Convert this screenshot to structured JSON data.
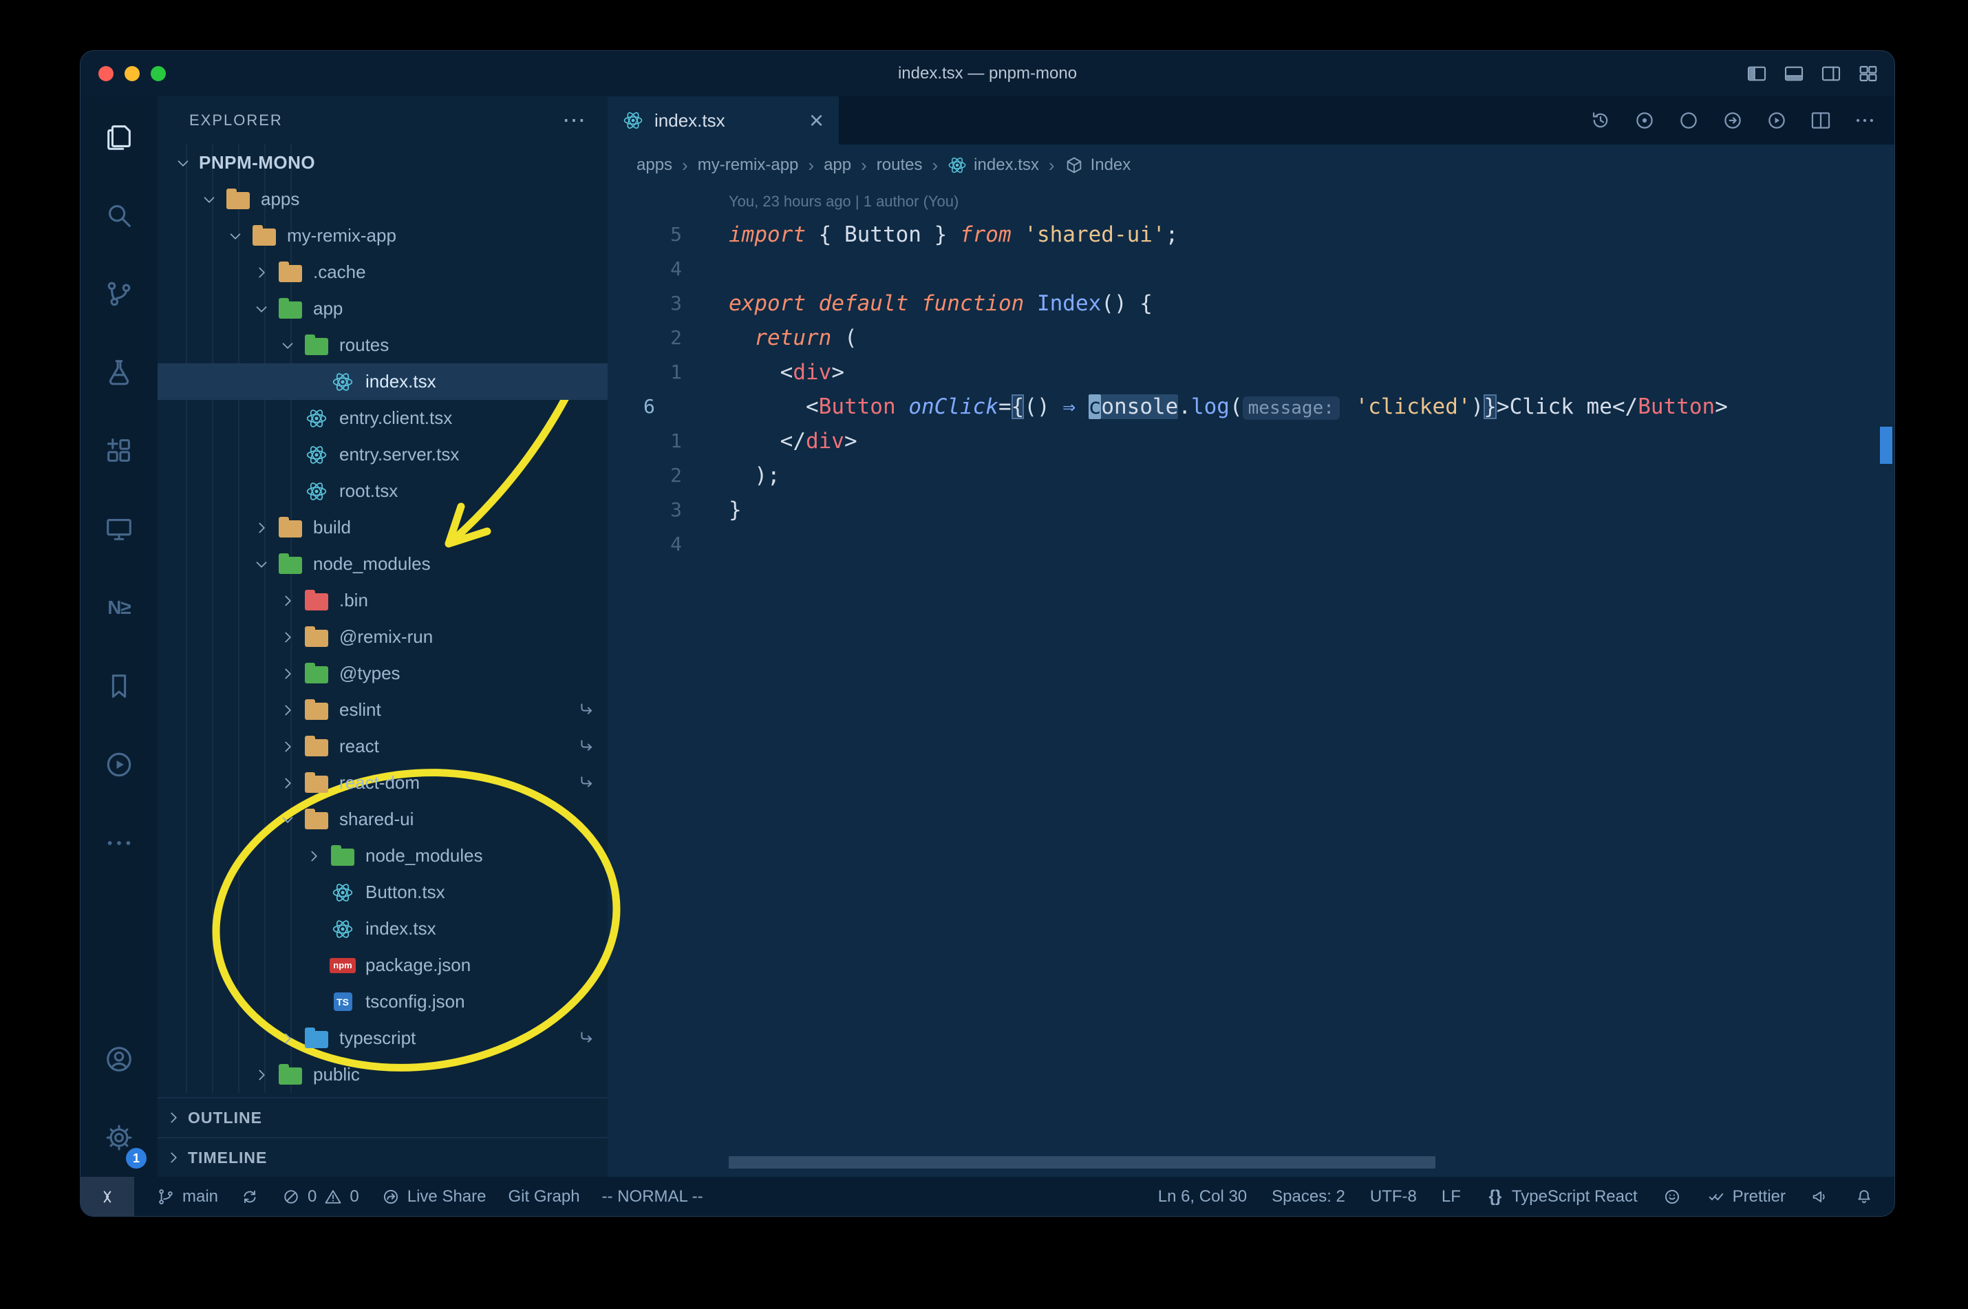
{
  "colors": {
    "editor_bg": "#0e2a44",
    "panel_bg": "#07192c",
    "sidebar_bg": "#0c2439",
    "activity_bg": "#091d31",
    "titlebar_bg": "#0a1e33",
    "statusbar_bg": "#081d31",
    "selection_row": "#1c3a57",
    "text": "#d6deeb",
    "dim": "#8ea6bf",
    "accent": "#82aaff",
    "keyword": "#f78c6c",
    "string": "#ecc48d",
    "tag": "#f07178",
    "folder_tan": "#d7a65f",
    "folder_green": "#4fae52",
    "folder_red": "#e25f5f",
    "folder_blue": "#3f9bd8",
    "react": "#58c4dc",
    "npm": "#cb3837",
    "ts": "#3178c6",
    "cursor": "#7ea6c9",
    "scroll_mark": "#3b8eea",
    "badge": "#2f7fe0",
    "annotation": "#f1e32b",
    "traffic_red": "#ff5f57",
    "traffic_yellow": "#febc2e",
    "traffic_green": "#28c840"
  },
  "titlebar": {
    "title": "index.tsx — pnpm-mono",
    "icons": [
      "layout-sidebar",
      "layout-panel",
      "layout-sidebar-right",
      "layout-grid"
    ]
  },
  "activity_bar": {
    "items": [
      {
        "name": "explorer",
        "icon": "files",
        "active": true
      },
      {
        "name": "search",
        "icon": "search"
      },
      {
        "name": "source-control",
        "icon": "source-control"
      },
      {
        "name": "testing",
        "icon": "flask"
      },
      {
        "name": "extensions",
        "icon": "extensions"
      },
      {
        "name": "remote-explorer",
        "icon": "remote"
      },
      {
        "name": "nx-console",
        "icon": "nx"
      },
      {
        "name": "bookmarks",
        "icon": "bookmark"
      },
      {
        "name": "code-runner",
        "icon": "circle-play-big"
      },
      {
        "name": "more-tools",
        "icon": "more"
      }
    ],
    "bottom": [
      {
        "name": "accounts",
        "icon": "account"
      },
      {
        "name": "settings",
        "icon": "gear",
        "badge": "1"
      }
    ]
  },
  "sidebar": {
    "header": "EXPLORER",
    "more": "⋯",
    "tree": [
      {
        "label": "PNPM-MONO",
        "level": 0,
        "kind": "root",
        "chevron": "down"
      },
      {
        "label": "apps",
        "level": 1,
        "kind": "folder",
        "color": "tan",
        "chevron": "down"
      },
      {
        "label": "my-remix-app",
        "level": 2,
        "kind": "folder",
        "color": "tan",
        "chevron": "down"
      },
      {
        "label": ".cache",
        "level": 3,
        "kind": "folder",
        "color": "tan",
        "chevron": "right"
      },
      {
        "label": "app",
        "level": 3,
        "kind": "folder",
        "color": "green",
        "chevron": "down"
      },
      {
        "label": "routes",
        "level": 4,
        "kind": "folder",
        "color": "green",
        "chevron": "down"
      },
      {
        "label": "index.tsx",
        "level": 5,
        "kind": "react",
        "selected": true
      },
      {
        "label": "entry.client.tsx",
        "level": 4,
        "kind": "react"
      },
      {
        "label": "entry.server.tsx",
        "level": 4,
        "kind": "react"
      },
      {
        "label": "root.tsx",
        "level": 4,
        "kind": "react"
      },
      {
        "label": "build",
        "level": 3,
        "kind": "folder",
        "color": "tan",
        "chevron": "right"
      },
      {
        "label": "node_modules",
        "level": 3,
        "kind": "folder",
        "color": "green",
        "chevron": "down"
      },
      {
        "label": ".bin",
        "level": 4,
        "kind": "folder",
        "color": "red",
        "chevron": "right"
      },
      {
        "label": "@remix-run",
        "level": 4,
        "kind": "folder",
        "color": "tan",
        "chevron": "right"
      },
      {
        "label": "@types",
        "level": 4,
        "kind": "folder",
        "color": "green",
        "chevron": "right"
      },
      {
        "label": "eslint",
        "level": 4,
        "kind": "folder",
        "color": "tan",
        "chevron": "right",
        "symlink": true
      },
      {
        "label": "react",
        "level": 4,
        "kind": "folder",
        "color": "tan",
        "chevron": "right",
        "symlink": true
      },
      {
        "label": "react-dom",
        "level": 4,
        "kind": "folder",
        "color": "tan",
        "chevron": "right",
        "symlink": true
      },
      {
        "label": "shared-ui",
        "level": 4,
        "kind": "folder",
        "color": "tan",
        "chevron": "down"
      },
      {
        "label": "node_modules",
        "level": 5,
        "kind": "folder",
        "color": "green",
        "chevron": "right"
      },
      {
        "label": "Button.tsx",
        "level": 5,
        "kind": "react"
      },
      {
        "label": "index.tsx",
        "level": 5,
        "kind": "react"
      },
      {
        "label": "package.json",
        "level": 5,
        "kind": "npm"
      },
      {
        "label": "tsconfig.json",
        "level": 5,
        "kind": "ts"
      },
      {
        "label": "typescript",
        "level": 4,
        "kind": "folder",
        "color": "blue",
        "chevron": "right",
        "symlink": true
      },
      {
        "label": "public",
        "level": 3,
        "kind": "folder",
        "color": "green",
        "chevron": "right"
      }
    ],
    "sections": [
      "OUTLINE",
      "TIMELINE"
    ]
  },
  "editor": {
    "tab": {
      "label": "index.tsx",
      "icon": "react",
      "close": "×"
    },
    "actions": [
      "history",
      "circle-dot",
      "circle-outline",
      "circle-arrow",
      "circle-play",
      "split",
      "more"
    ],
    "breadcrumbs": [
      {
        "label": "apps"
      },
      {
        "label": "my-remix-app"
      },
      {
        "label": "app"
      },
      {
        "label": "routes"
      },
      {
        "label": "index.tsx",
        "icon": "react"
      },
      {
        "label": "Index",
        "icon": "cube"
      }
    ],
    "codelens": "You, 23 hours ago | 1 author (You)",
    "code": {
      "lines": [
        {
          "num": "5",
          "tokens": [
            {
              "t": "import",
              "c": "kw"
            },
            {
              "t": " { ",
              "c": "pn"
            },
            {
              "t": "Button",
              "c": "var"
            },
            {
              "t": " } ",
              "c": "pn"
            },
            {
              "t": "from",
              "c": "kw"
            },
            {
              "t": " ",
              "c": "pn"
            },
            {
              "t": "'shared-ui'",
              "c": "str"
            },
            {
              "t": ";",
              "c": "pn"
            }
          ]
        },
        {
          "num": "4",
          "tokens": []
        },
        {
          "num": "3",
          "tokens": [
            {
              "t": "export",
              "c": "kw"
            },
            {
              "t": " ",
              "c": "pn"
            },
            {
              "t": "default",
              "c": "kw"
            },
            {
              "t": " ",
              "c": "pn"
            },
            {
              "t": "function",
              "c": "kw"
            },
            {
              "t": " ",
              "c": "pn"
            },
            {
              "t": "Index",
              "c": "fn"
            },
            {
              "t": "() {",
              "c": "pn"
            }
          ]
        },
        {
          "num": "2",
          "tokens": [
            {
              "t": "  ",
              "c": "pn"
            },
            {
              "t": "return",
              "c": "kw"
            },
            {
              "t": " (",
              "c": "pn"
            }
          ]
        },
        {
          "num": "1",
          "tokens": [
            {
              "t": "    <",
              "c": "pn"
            },
            {
              "t": "div",
              "c": "tag"
            },
            {
              "t": ">",
              "c": "pn"
            }
          ]
        },
        {
          "num": "6",
          "current": true,
          "tokens": [
            {
              "t": "      <",
              "c": "pn"
            },
            {
              "t": "Button",
              "c": "tag"
            },
            {
              "t": " ",
              "c": "pn"
            },
            {
              "t": "onClick",
              "c": "attr"
            },
            {
              "t": "=",
              "c": "pn"
            },
            {
              "t": "{",
              "c": "bhl"
            },
            {
              "t": "()",
              "c": "pn"
            },
            {
              "t": " ",
              "c": "pn"
            },
            {
              "t": "⇒",
              "c": "arrow"
            },
            {
              "t": " ",
              "c": "pn"
            },
            {
              "t": "c",
              "c": "cursor"
            },
            {
              "t": "onsole",
              "c": "whl"
            },
            {
              "t": ".",
              "c": "pn"
            },
            {
              "t": "log",
              "c": "fn"
            },
            {
              "t": "(",
              "c": "pn"
            },
            {
              "t": "message:",
              "c": "inlay"
            },
            {
              "t": " ",
              "c": "pn"
            },
            {
              "t": "'clicked'",
              "c": "str"
            },
            {
              "t": ")",
              "c": "pn"
            },
            {
              "t": "}",
              "c": "bhl"
            },
            {
              "t": ">",
              "c": "pn"
            },
            {
              "t": "Click me",
              "c": "txt"
            },
            {
              "t": "</",
              "c": "pn"
            },
            {
              "t": "Button",
              "c": "tag"
            },
            {
              "t": ">",
              "c": "pn"
            }
          ]
        },
        {
          "num": "1",
          "tokens": [
            {
              "t": "    </",
              "c": "pn"
            },
            {
              "t": "div",
              "c": "tag"
            },
            {
              "t": ">",
              "c": "pn"
            }
          ]
        },
        {
          "num": "2",
          "tokens": [
            {
              "t": "  );",
              "c": "pn"
            }
          ]
        },
        {
          "num": "3",
          "tokens": [
            {
              "t": "}",
              "c": "pn"
            }
          ]
        },
        {
          "num": "4",
          "tokens": []
        }
      ]
    }
  },
  "statusbar": {
    "left": [
      {
        "name": "remote-indicator",
        "kind": "remote",
        "segments": [
          {
            "icon": "remote-sb"
          }
        ]
      },
      {
        "name": "git-branch",
        "segments": [
          {
            "icon": "branch"
          },
          {
            "text": "main"
          }
        ]
      },
      {
        "name": "sync-changes",
        "segments": [
          {
            "icon": "sync"
          }
        ]
      },
      {
        "name": "problems",
        "segments": [
          {
            "icon": "error"
          },
          {
            "text": "0"
          },
          {
            "icon": "warning"
          },
          {
            "text": "0"
          }
        ]
      },
      {
        "name": "live-share",
        "segments": [
          {
            "icon": "liveshare"
          },
          {
            "text": "Live Share"
          }
        ]
      },
      {
        "name": "git-graph",
        "segments": [
          {
            "text": "Git Graph"
          }
        ]
      },
      {
        "name": "vim-mode",
        "segments": [
          {
            "text": "-- NORMAL --"
          }
        ]
      }
    ],
    "right": [
      {
        "name": "cursor-position",
        "segments": [
          {
            "text": "Ln 6, Col 30"
          }
        ]
      },
      {
        "name": "indentation",
        "segments": [
          {
            "text": "Spaces: 2"
          }
        ]
      },
      {
        "name": "encoding",
        "segments": [
          {
            "text": "UTF-8"
          }
        ]
      },
      {
        "name": "eol",
        "segments": [
          {
            "text": "LF"
          }
        ]
      },
      {
        "name": "language-mode",
        "segments": [
          {
            "icon": "braces-text"
          },
          {
            "text": "TypeScript React"
          }
        ]
      },
      {
        "name": "feedback",
        "segments": [
          {
            "icon": "smiley"
          }
        ]
      },
      {
        "name": "prettier",
        "segments": [
          {
            "icon": "check2"
          },
          {
            "text": "Prettier"
          }
        ]
      },
      {
        "name": "announce",
        "segments": [
          {
            "icon": "megaphone"
          }
        ]
      },
      {
        "name": "notifications",
        "segments": [
          {
            "icon": "bell"
          }
        ]
      }
    ]
  },
  "annotations": {
    "shapes": [
      "arrow",
      "ellipse"
    ],
    "color": "#f1e32b"
  }
}
